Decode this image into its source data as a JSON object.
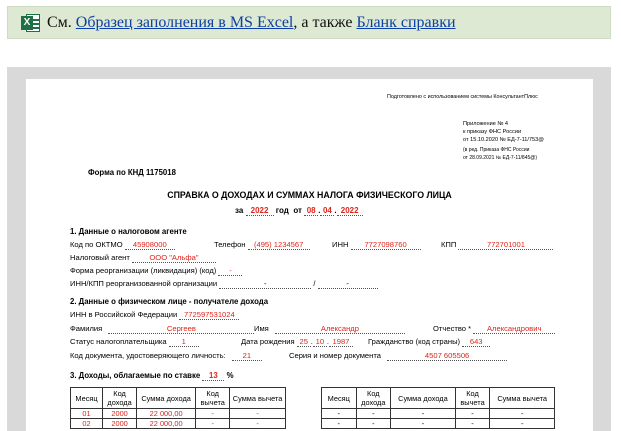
{
  "banner": {
    "prefix": "См.",
    "link1": "Образец заполнения в MS Excel",
    "middle": ", а также",
    "link2": "Бланк справки",
    "icon": "excel-icon",
    "icon_letter": "X"
  },
  "form": {
    "consultant": "Подготовлено с использованием системы КонсультантПлюс",
    "appendix": [
      "Приложение № 4",
      "к приказу ФНС России",
      "от 15.10.2020 № ЕД-7-11/753@",
      "(в ред. Приказа ФНС России",
      "от 28.09.2021 № ЕД-7-11/845@)"
    ],
    "knd": "Форма по КНД 1175018",
    "title": "СПРАВКА О ДОХОДАХ И СУММАХ НАЛОГА ФИЗИЧЕСКОГО ЛИЦА",
    "za": "за",
    "year": "2022",
    "god": "год",
    "ot": "от",
    "day": "08",
    "month": "04",
    "date_year": "2022",
    "dot": ".",
    "section1": "1. Данные о налоговом агенте",
    "oktmo_label": "Код по ОКТМО",
    "oktmo": "45908000",
    "phone_label": "Телефон",
    "phone": "(495) 1234567",
    "inn_label": "ИНН",
    "inn": "7727098760",
    "kpp_label": "КПП",
    "kpp": "772701001",
    "agent_label": "Налоговый агент",
    "agent": "ООО \"Альфа\"",
    "reorg_label": "Форма реорганизации (ликвидация) (код)",
    "reorg": "-",
    "reorg_inn_label": "ИНН/КПП реорганизованной организации",
    "reorg_inn": "-",
    "slash": "/",
    "reorg_kpp": "-",
    "section2": "2. Данные о физическом лице - получателе дохода",
    "inn_rf_label": "ИНН в Российской Федерации",
    "inn_rf": "772597531024",
    "fam_label": "Фамилия",
    "fam": "Сергеев",
    "name_label": "Имя",
    "name": "Александр",
    "otch_label": "Отчество *",
    "otch": "Александрович",
    "status_label": "Статус налогоплательщика",
    "status": "1",
    "birth_label": "Дата рождения",
    "birth_day": "25",
    "birth_month": "10",
    "birth_year": "1987",
    "citizen_label": "Гражданство (код страны)",
    "citizen": "643",
    "doc_label": "Код документа, удостоверяющего личность:",
    "doc": "21",
    "series_label": "Серия и номер документа",
    "series": "4507 605506",
    "section3": "3. Доходы, облагаемые по ставке",
    "rate": "13",
    "percent": "%"
  },
  "income_table": {
    "headers": [
      "Месяц",
      "Код дохода",
      "Сумма дохода",
      "Код вычета",
      "Сумма вычета"
    ],
    "left_rows": [
      [
        "01",
        "2000",
        "22 000,00",
        "-",
        "-"
      ],
      [
        "02",
        "2000",
        "22 000,00",
        "-",
        "-"
      ]
    ],
    "right_rows": [
      [
        "-",
        "-",
        "-",
        "-",
        "-"
      ],
      [
        "-",
        "-",
        "-",
        "-",
        "-"
      ]
    ]
  }
}
